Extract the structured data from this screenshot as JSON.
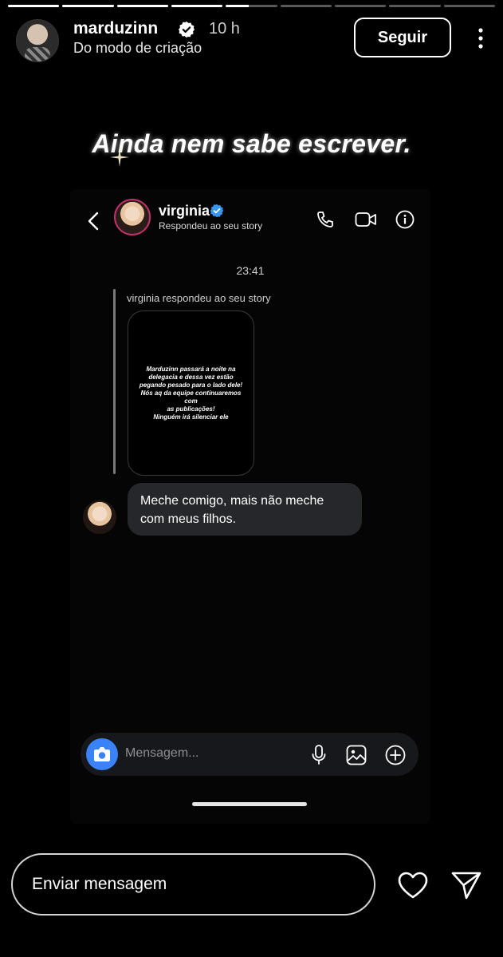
{
  "story": {
    "progress": [
      1,
      1,
      1,
      1,
      0.45,
      0,
      0,
      0,
      0
    ]
  },
  "header": {
    "username": "marduzinn",
    "time": "10 h",
    "subtitle": "Do modo de criação",
    "follow_label": "Seguir"
  },
  "caption": "Ainda nem sabe escrever.",
  "dm": {
    "name": "virginia",
    "subtitle": "Respondeu ao seu story",
    "timestamp": "23:41",
    "replied_label": "virginia respondeu ao seu story",
    "story_text": "Marduzinn passará a noite na\ndelegacia e dessa vez estão\npegando pesado para o lado dele!\nNós aq da equipe continuaremos com\nas publicações!\nNinguém irá silenciar ele",
    "message": "Meche comigo, mais não meche com meus filhos.",
    "input_placeholder": "Mensagem..."
  },
  "reply": {
    "placeholder": "Enviar mensagem"
  },
  "colors": {
    "background": "#000000",
    "verified": "#3897f0",
    "camera_button": "#3a82f7",
    "bubble": "#26272b"
  }
}
